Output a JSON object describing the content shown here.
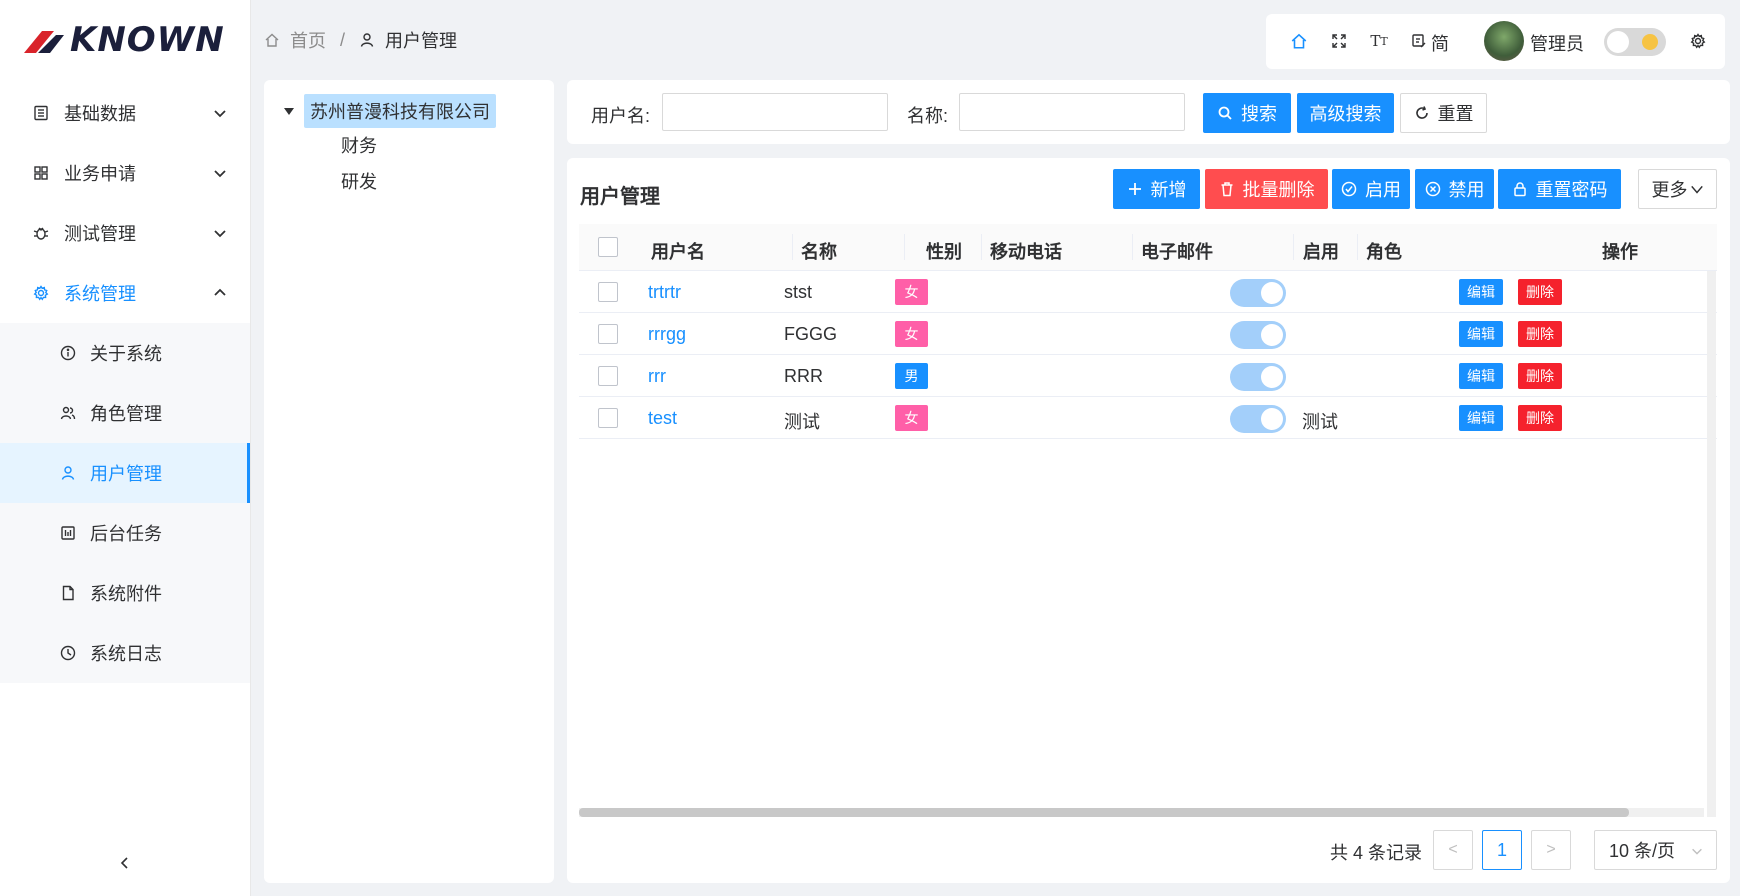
{
  "sidebar": {
    "logo_text": "KNOWN",
    "groups": [
      {
        "label": "基础数据"
      },
      {
        "label": "业务申请"
      },
      {
        "label": "测试管理"
      },
      {
        "label": "系统管理"
      }
    ],
    "sub_items": [
      {
        "label": "关于系统"
      },
      {
        "label": "角色管理"
      },
      {
        "label": "用户管理"
      },
      {
        "label": "后台任务"
      },
      {
        "label": "系统附件"
      },
      {
        "label": "系统日志"
      }
    ]
  },
  "breadcrumb": {
    "home": "首页",
    "separator": "/",
    "current": "用户管理"
  },
  "topbar": {
    "lang": "简",
    "user": "管理员"
  },
  "tree": {
    "root": "苏州普漫科技有限公司",
    "children": [
      "财务",
      "研发"
    ]
  },
  "search": {
    "username_label": "用户名:",
    "name_label": "名称:",
    "search_btn": "搜索",
    "advanced_btn": "高级搜索",
    "reset_btn": "重置"
  },
  "main": {
    "title": "用户管理",
    "toolbar": {
      "add": "新增",
      "batch_delete": "批量删除",
      "enable": "启用",
      "disable": "禁用",
      "reset_pwd": "重置密码",
      "more": "更多"
    },
    "columns": [
      "用户名",
      "名称",
      "性别",
      "移动电话",
      "电子邮件",
      "启用",
      "角色",
      "操作"
    ],
    "rows": [
      {
        "username": "trtrtr",
        "name": "stst",
        "gender": "女",
        "phone": "",
        "email": "",
        "enabled": true,
        "role": ""
      },
      {
        "username": "rrrgg",
        "name": "FGGG",
        "gender": "女",
        "phone": "",
        "email": "",
        "enabled": true,
        "role": ""
      },
      {
        "username": "rrr",
        "name": "RRR",
        "gender": "男",
        "phone": "",
        "email": "",
        "enabled": true,
        "role": ""
      },
      {
        "username": "test",
        "name": "测试",
        "gender": "女",
        "phone": "",
        "email": "",
        "enabled": true,
        "role": "测试"
      }
    ],
    "row_actions": {
      "edit": "编辑",
      "delete": "删除"
    },
    "pagination": {
      "total": "共 4 条记录",
      "prev": "<",
      "page": "1",
      "next": ">",
      "page_size": "10 条/页"
    }
  },
  "colors": {
    "primary": "#1890ff",
    "danger": "#ff4d4f",
    "female": "#ff5fa8",
    "male": "#1890ff"
  }
}
